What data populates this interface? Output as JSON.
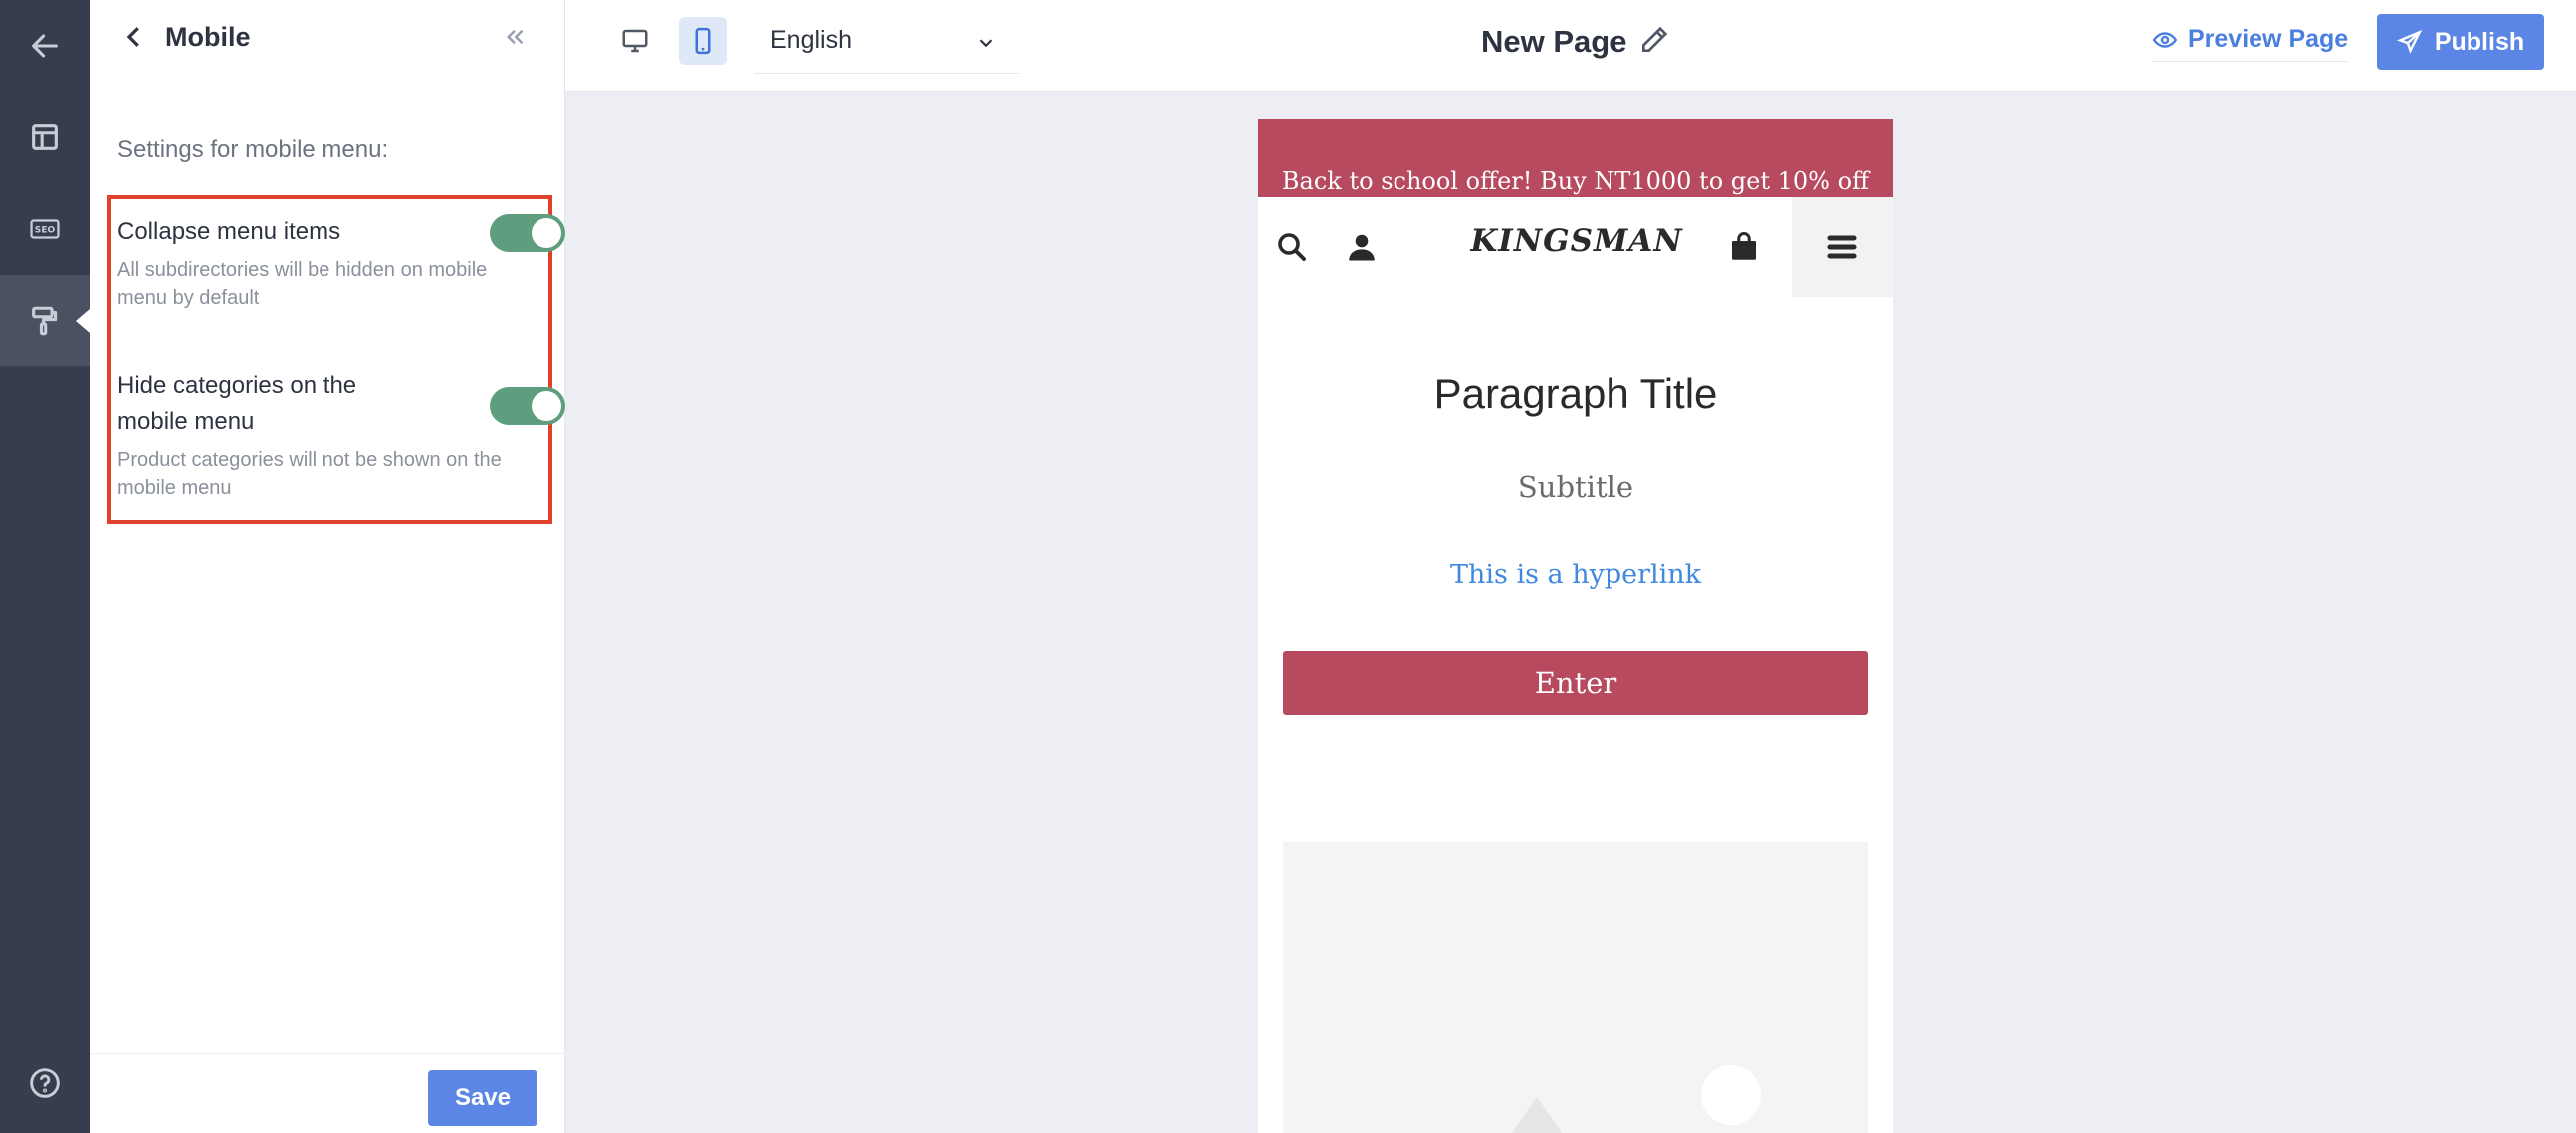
{
  "rail": {
    "items": [
      {
        "icon": "back-arrow-icon"
      },
      {
        "icon": "layout-icon"
      },
      {
        "icon": "seo-icon",
        "label": "SEO"
      },
      {
        "icon": "paint-roller-icon",
        "active": true
      }
    ],
    "help_icon": "question-mark-icon"
  },
  "panel": {
    "title": "Mobile",
    "heading": "Settings for mobile menu:",
    "settings": [
      {
        "title": "Collapse menu items",
        "description": "All subdirectories will be hidden on mobile menu by default",
        "enabled": true
      },
      {
        "title": "Hide categories on the mobile menu",
        "description": "Product categories will not be shown on the mobile menu",
        "enabled": true
      }
    ],
    "save_label": "Save"
  },
  "topbar": {
    "views": [
      {
        "icon": "desktop-icon",
        "active": false
      },
      {
        "icon": "mobile-icon",
        "active": true
      }
    ],
    "language": "English",
    "page_title": "New Page",
    "preview_label": "Preview Page",
    "publish_label": "Publish"
  },
  "preview": {
    "promo_text": "Back to school offer! Buy NT1000 to get 10% off",
    "logo": "KINGSMAN",
    "paragraph_title": "Paragraph Title",
    "subtitle": "Subtitle",
    "hyperlink": "This is a hyperlink",
    "button_label": "Enter"
  },
  "colors": {
    "accent": "#5b86e5",
    "brand": "#b84a60",
    "toggle_on": "#5e9e7e",
    "highlight": "#e0412b",
    "link": "#3f89e0"
  }
}
